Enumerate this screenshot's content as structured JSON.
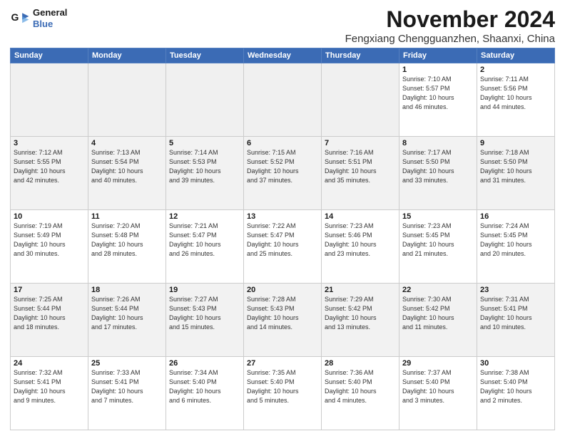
{
  "header": {
    "logo_line1": "General",
    "logo_line2": "Blue",
    "month": "November 2024",
    "location": "Fengxiang Chengguanzhen, Shaanxi, China"
  },
  "days_of_week": [
    "Sunday",
    "Monday",
    "Tuesday",
    "Wednesday",
    "Thursday",
    "Friday",
    "Saturday"
  ],
  "weeks": [
    [
      {
        "day": "",
        "info": ""
      },
      {
        "day": "",
        "info": ""
      },
      {
        "day": "",
        "info": ""
      },
      {
        "day": "",
        "info": ""
      },
      {
        "day": "",
        "info": ""
      },
      {
        "day": "1",
        "info": "Sunrise: 7:10 AM\nSunset: 5:57 PM\nDaylight: 10 hours\nand 46 minutes."
      },
      {
        "day": "2",
        "info": "Sunrise: 7:11 AM\nSunset: 5:56 PM\nDaylight: 10 hours\nand 44 minutes."
      }
    ],
    [
      {
        "day": "3",
        "info": "Sunrise: 7:12 AM\nSunset: 5:55 PM\nDaylight: 10 hours\nand 42 minutes."
      },
      {
        "day": "4",
        "info": "Sunrise: 7:13 AM\nSunset: 5:54 PM\nDaylight: 10 hours\nand 40 minutes."
      },
      {
        "day": "5",
        "info": "Sunrise: 7:14 AM\nSunset: 5:53 PM\nDaylight: 10 hours\nand 39 minutes."
      },
      {
        "day": "6",
        "info": "Sunrise: 7:15 AM\nSunset: 5:52 PM\nDaylight: 10 hours\nand 37 minutes."
      },
      {
        "day": "7",
        "info": "Sunrise: 7:16 AM\nSunset: 5:51 PM\nDaylight: 10 hours\nand 35 minutes."
      },
      {
        "day": "8",
        "info": "Sunrise: 7:17 AM\nSunset: 5:50 PM\nDaylight: 10 hours\nand 33 minutes."
      },
      {
        "day": "9",
        "info": "Sunrise: 7:18 AM\nSunset: 5:50 PM\nDaylight: 10 hours\nand 31 minutes."
      }
    ],
    [
      {
        "day": "10",
        "info": "Sunrise: 7:19 AM\nSunset: 5:49 PM\nDaylight: 10 hours\nand 30 minutes."
      },
      {
        "day": "11",
        "info": "Sunrise: 7:20 AM\nSunset: 5:48 PM\nDaylight: 10 hours\nand 28 minutes."
      },
      {
        "day": "12",
        "info": "Sunrise: 7:21 AM\nSunset: 5:47 PM\nDaylight: 10 hours\nand 26 minutes."
      },
      {
        "day": "13",
        "info": "Sunrise: 7:22 AM\nSunset: 5:47 PM\nDaylight: 10 hours\nand 25 minutes."
      },
      {
        "day": "14",
        "info": "Sunrise: 7:23 AM\nSunset: 5:46 PM\nDaylight: 10 hours\nand 23 minutes."
      },
      {
        "day": "15",
        "info": "Sunrise: 7:23 AM\nSunset: 5:45 PM\nDaylight: 10 hours\nand 21 minutes."
      },
      {
        "day": "16",
        "info": "Sunrise: 7:24 AM\nSunset: 5:45 PM\nDaylight: 10 hours\nand 20 minutes."
      }
    ],
    [
      {
        "day": "17",
        "info": "Sunrise: 7:25 AM\nSunset: 5:44 PM\nDaylight: 10 hours\nand 18 minutes."
      },
      {
        "day": "18",
        "info": "Sunrise: 7:26 AM\nSunset: 5:44 PM\nDaylight: 10 hours\nand 17 minutes."
      },
      {
        "day": "19",
        "info": "Sunrise: 7:27 AM\nSunset: 5:43 PM\nDaylight: 10 hours\nand 15 minutes."
      },
      {
        "day": "20",
        "info": "Sunrise: 7:28 AM\nSunset: 5:43 PM\nDaylight: 10 hours\nand 14 minutes."
      },
      {
        "day": "21",
        "info": "Sunrise: 7:29 AM\nSunset: 5:42 PM\nDaylight: 10 hours\nand 13 minutes."
      },
      {
        "day": "22",
        "info": "Sunrise: 7:30 AM\nSunset: 5:42 PM\nDaylight: 10 hours\nand 11 minutes."
      },
      {
        "day": "23",
        "info": "Sunrise: 7:31 AM\nSunset: 5:41 PM\nDaylight: 10 hours\nand 10 minutes."
      }
    ],
    [
      {
        "day": "24",
        "info": "Sunrise: 7:32 AM\nSunset: 5:41 PM\nDaylight: 10 hours\nand 9 minutes."
      },
      {
        "day": "25",
        "info": "Sunrise: 7:33 AM\nSunset: 5:41 PM\nDaylight: 10 hours\nand 7 minutes."
      },
      {
        "day": "26",
        "info": "Sunrise: 7:34 AM\nSunset: 5:40 PM\nDaylight: 10 hours\nand 6 minutes."
      },
      {
        "day": "27",
        "info": "Sunrise: 7:35 AM\nSunset: 5:40 PM\nDaylight: 10 hours\nand 5 minutes."
      },
      {
        "day": "28",
        "info": "Sunrise: 7:36 AM\nSunset: 5:40 PM\nDaylight: 10 hours\nand 4 minutes."
      },
      {
        "day": "29",
        "info": "Sunrise: 7:37 AM\nSunset: 5:40 PM\nDaylight: 10 hours\nand 3 minutes."
      },
      {
        "day": "30",
        "info": "Sunrise: 7:38 AM\nSunset: 5:40 PM\nDaylight: 10 hours\nand 2 minutes."
      }
    ]
  ]
}
